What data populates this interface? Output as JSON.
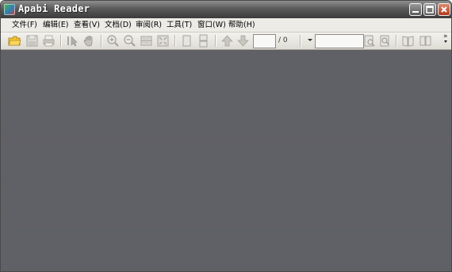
{
  "window": {
    "title": "Apabi Reader"
  },
  "menu": [
    {
      "label": "文件(F)"
    },
    {
      "label": "编辑(E)"
    },
    {
      "label": "查看(V)"
    },
    {
      "label": "文档(D)"
    },
    {
      "label": "审阅(R)"
    },
    {
      "label": "工具(T)"
    },
    {
      "label": "窗口(W)"
    },
    {
      "label": "帮助(H)"
    }
  ],
  "toolbar": {
    "page_current": "",
    "page_total": "/ 0",
    "search_value": "",
    "overflow": "»",
    "tools": [
      "open-folder-icon",
      "save-icon",
      "print-icon",
      "select-cursor-icon",
      "hand-icon",
      "zoom-in-icon",
      "zoom-out-icon",
      "fit-width-icon",
      "fit-page-icon",
      "single-page-icon",
      "continuous-page-icon",
      "previous-page-icon",
      "next-page-icon",
      "find-previous-icon",
      "find-next-icon",
      "book-view-icon",
      "two-page-view-icon"
    ]
  },
  "colors": {
    "workspace": "#5f5f66",
    "titlebar": "#4a4a4a",
    "folder": "#f0c030"
  }
}
